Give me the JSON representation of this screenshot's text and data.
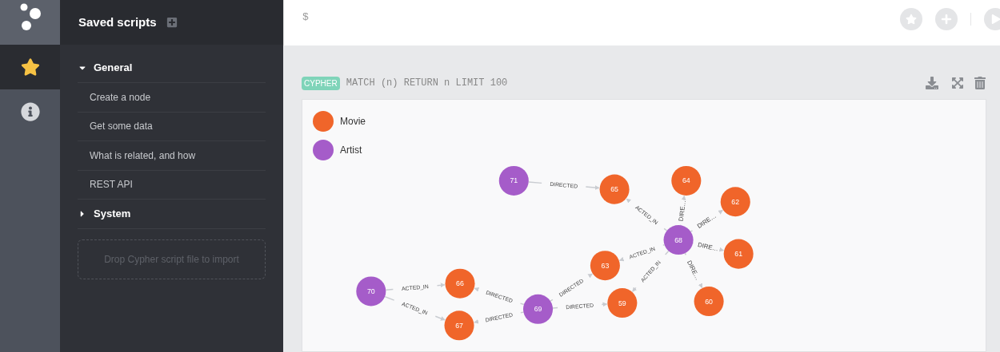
{
  "nav": [
    {
      "kind": "star",
      "selected": true
    },
    {
      "kind": "info",
      "selected": false
    }
  ],
  "drawer": {
    "title": "Saved scripts",
    "folders": [
      {
        "name": "General",
        "expanded": true,
        "scripts": [
          "Create a node",
          "Get some data",
          "What is related, and how",
          "REST API"
        ]
      },
      {
        "name": "System",
        "expanded": false
      }
    ],
    "drop_zone": "Drop Cypher script file to import"
  },
  "editor": {
    "prompt": "$"
  },
  "frame": {
    "badge": "CYPHER",
    "query": "MATCH (n) RETURN n LIMIT 100",
    "legend": [
      {
        "label": "Movie",
        "color": "#f0652a"
      },
      {
        "label": "Artist",
        "color": "#a55cc9"
      }
    ],
    "nodes": [
      {
        "label": "71",
        "color": "#a55cc9"
      },
      {
        "label": "65",
        "color": "#f0652a"
      },
      {
        "label": "64",
        "color": "#f0652a"
      },
      {
        "label": "62",
        "color": "#f0652a"
      },
      {
        "label": "68",
        "color": "#a55cc9"
      },
      {
        "label": "61",
        "color": "#f0652a"
      },
      {
        "label": "63",
        "color": "#f0652a"
      },
      {
        "label": "60",
        "color": "#f0652a"
      },
      {
        "label": "59",
        "color": "#f0652a"
      },
      {
        "label": "69",
        "color": "#a55cc9"
      },
      {
        "label": "66",
        "color": "#f0652a"
      },
      {
        "label": "67",
        "color": "#f0652a"
      },
      {
        "label": "70",
        "color": "#a55cc9"
      }
    ],
    "relationships": [
      {
        "label": "DIRECTED"
      },
      {
        "label": "ACTED_IN"
      },
      {
        "label": "DIRE…"
      },
      {
        "label": "DIRE…"
      },
      {
        "label": "DIRE…"
      },
      {
        "label": "DIRE…"
      },
      {
        "label": "ACTED_IN"
      },
      {
        "label": "ACTED_IN"
      },
      {
        "label": "DIRECTED"
      },
      {
        "label": "DIRECTED"
      },
      {
        "label": "DIRECTED"
      },
      {
        "label": "DIRECTED"
      },
      {
        "label": "ACTED_IN"
      },
      {
        "label": "ACTED_IN"
      }
    ]
  }
}
